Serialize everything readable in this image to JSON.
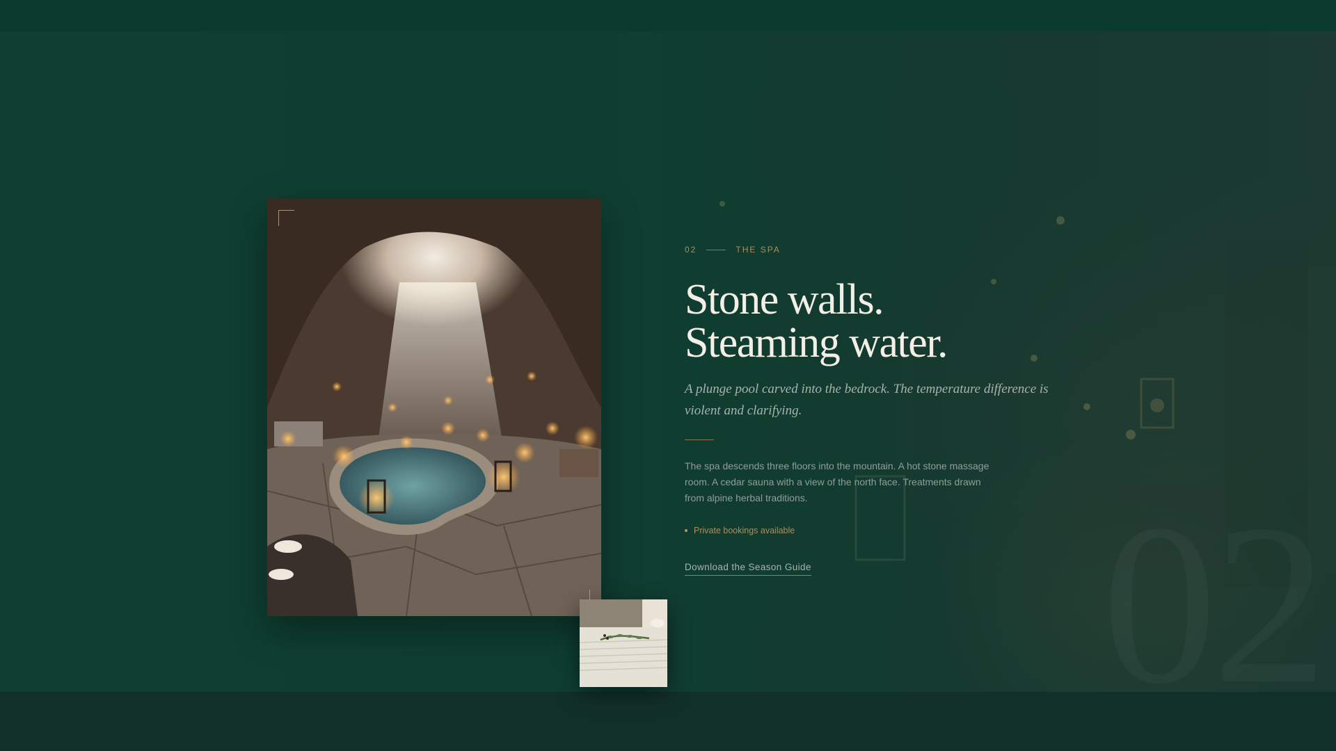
{
  "section": {
    "number": "02",
    "eyebrow": "THE SPA",
    "headline_line1": "Stone walls.",
    "headline_line2": "Steaming water.",
    "lede": "A plunge pool carved into the bedrock. The temperature difference is violent and clarifying.",
    "body": "The spa descends three floors into the mountain. A hot stone massage room. A cedar sauna with a view of the north face. Treatments drawn from alpine herbal traditions.",
    "note": "Private bookings available",
    "cta_label": "Download the Season Guide",
    "watermark": "02"
  },
  "images": {
    "hero": "candlelit cave spa with plunge pool",
    "thumb": "folded towel with herb sprig"
  },
  "colors": {
    "accent": "#a98f5c",
    "background": "#0e3f31",
    "heading": "#f3efe6",
    "text_muted": "#8f9e96"
  }
}
